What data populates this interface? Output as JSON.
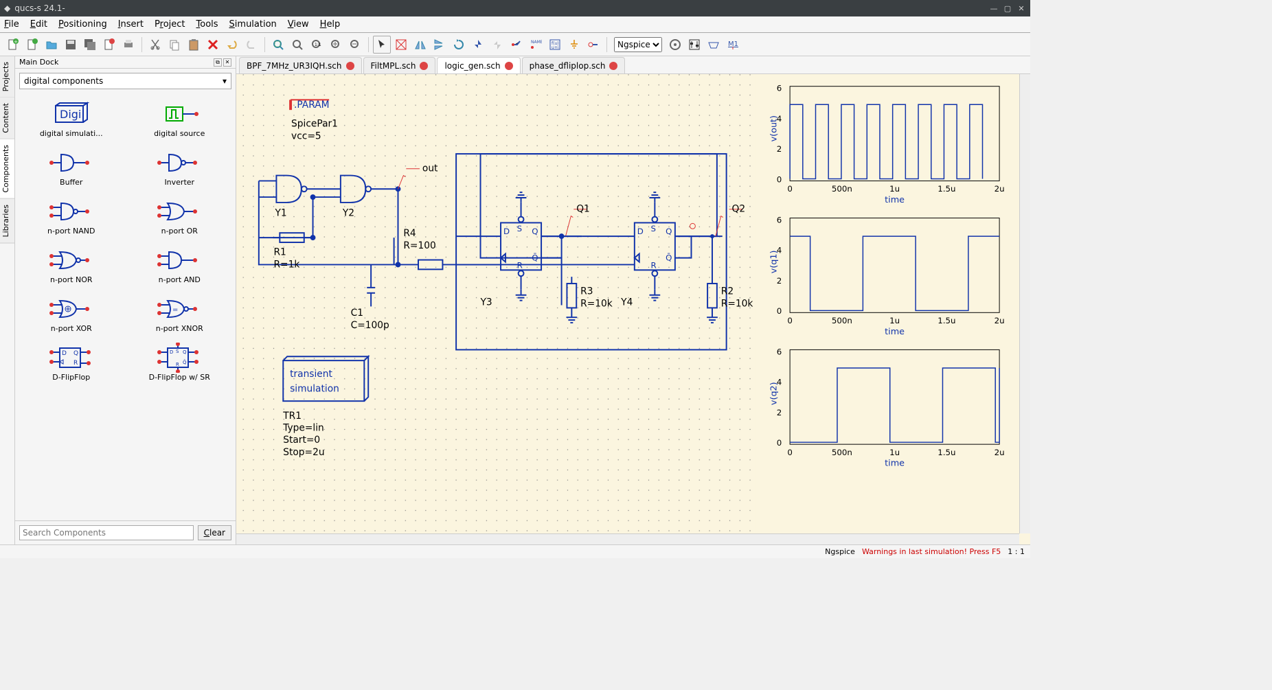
{
  "window": {
    "title": "qucs-s 24.1-"
  },
  "menu": {
    "file": "File",
    "edit": "Edit",
    "positioning": "Positioning",
    "insert": "Insert",
    "project": "Project",
    "tools": "Tools",
    "simulation": "Simulation",
    "view": "View",
    "help": "Help"
  },
  "simulator": {
    "selected": "Ngspice"
  },
  "dock": {
    "title": "Main Dock",
    "sidetabs": {
      "projects": "Projects",
      "content": "Content",
      "components": "Components",
      "libraries": "Libraries"
    },
    "category": "digital components",
    "search_placeholder": "Search Components",
    "clear": "Clear",
    "items": [
      {
        "label": "digital simulati..."
      },
      {
        "label": "digital source"
      },
      {
        "label": "Buffer"
      },
      {
        "label": "Inverter"
      },
      {
        "label": "n-port NAND"
      },
      {
        "label": "n-port OR"
      },
      {
        "label": "n-port NOR"
      },
      {
        "label": "n-port AND"
      },
      {
        "label": "n-port XOR"
      },
      {
        "label": "n-port XNOR"
      },
      {
        "label": "D-FlipFlop"
      },
      {
        "label": "D-FlipFlop w/ SR"
      }
    ]
  },
  "tabs": [
    {
      "label": "BPF_7MHz_UR3IQH.sch",
      "active": false
    },
    {
      "label": "FiltMPL.sch",
      "active": false
    },
    {
      "label": "logic_gen.sch",
      "active": true
    },
    {
      "label": "phase_dfliplop.sch",
      "active": false
    }
  ],
  "schematic": {
    "param": {
      "header": ".PARAM",
      "name": "SpicePar1",
      "line1": "vcc=5"
    },
    "sim": {
      "header1": "transient",
      "header2": "simulation",
      "name": "TR1",
      "line1": "Type=lin",
      "line2": "Start=0",
      "line3": "Stop=2u"
    },
    "labels": {
      "y1": "Y1",
      "y2": "Y2",
      "y3": "Y3",
      "y4": "Y4",
      "r1n": "R1",
      "r1v": "R=1k",
      "r4n": "R4",
      "r4v": "R=100",
      "c1n": "C1",
      "c1v": "C=100p",
      "r3n": "R3",
      "r3v": "R=10k",
      "r2n": "R2",
      "r2v": "R=10k",
      "out": "out",
      "q1": "Q1",
      "q2": "Q2"
    }
  },
  "status": {
    "kernel": "Ngspice",
    "warning": "Warnings in last simulation! Press F5",
    "zoom": "1 : 1"
  },
  "chart_data": [
    {
      "type": "line",
      "title": "v(out)",
      "xlabel": "time",
      "x_unit": "s",
      "xlim": [
        0,
        2e-06
      ],
      "xticks": [
        0,
        5e-07,
        1e-06,
        1.5e-06,
        2e-06
      ],
      "xtick_labels": [
        "0",
        "500n",
        "1u",
        "1.5u",
        "2u"
      ],
      "ylim": [
        0,
        6
      ],
      "yticks": [
        0,
        2,
        4,
        6
      ],
      "description": "square wave ~5 Vpp, 8 cycles over 2 us (period ~250 ns, low ~0 V, high ~5 V)"
    },
    {
      "type": "line",
      "title": "v(q1)",
      "xlabel": "time",
      "x_unit": "s",
      "xlim": [
        0,
        2e-06
      ],
      "xticks": [
        0,
        5e-07,
        1e-06,
        1.5e-06,
        2e-06
      ],
      "xtick_labels": [
        "0",
        "500n",
        "1u",
        "1.5u",
        "2u"
      ],
      "ylim": [
        0,
        6
      ],
      "yticks": [
        0,
        2,
        4,
        6
      ],
      "description": "square wave ~5 Vpp, 2 cycles over 2 us (divide-by-4, period ~1 us)"
    },
    {
      "type": "line",
      "title": "v(q2)",
      "xlabel": "time",
      "x_unit": "s",
      "xlim": [
        0,
        2e-06
      ],
      "xticks": [
        0,
        5e-07,
        1e-06,
        1.5e-06,
        2e-06
      ],
      "xtick_labels": [
        "0",
        "500n",
        "1u",
        "1.5u",
        "2u"
      ],
      "ylim": [
        0,
        6
      ],
      "yticks": [
        0,
        2,
        4,
        6
      ],
      "description": "square wave ~5 Vpp, 2 cycles over 2 us, phase-shifted vs v(q1)"
    }
  ]
}
